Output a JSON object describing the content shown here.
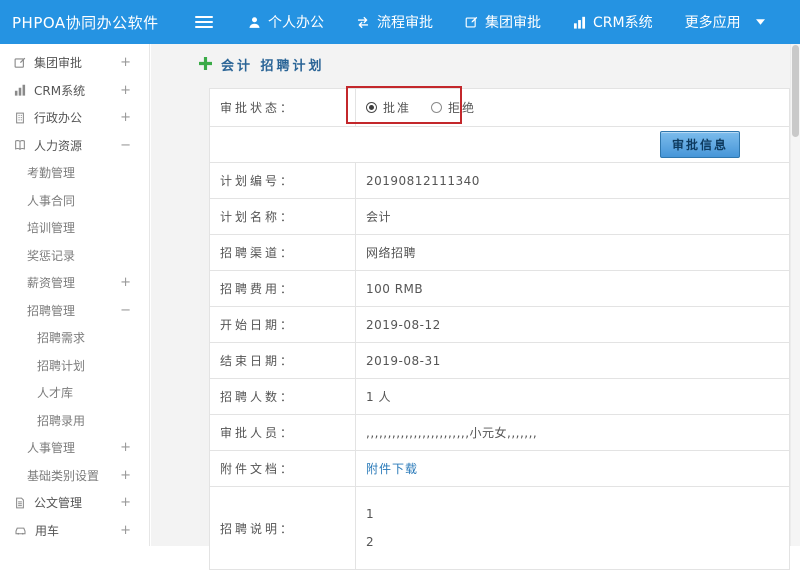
{
  "topbar": {
    "logo": "PHPOA协同办公软件",
    "nav": [
      {
        "label": "个人办公",
        "icon": "person-icon"
      },
      {
        "label": "流程审批",
        "icon": "process-icon"
      },
      {
        "label": "集团审批",
        "icon": "edit-icon"
      },
      {
        "label": "CRM系统",
        "icon": "chart-icon"
      },
      {
        "label": "更多应用",
        "icon": "caret-down-icon"
      }
    ]
  },
  "sidebar": {
    "items": [
      {
        "label": "集团审批",
        "icon": "edit-icon",
        "toggle": "+"
      },
      {
        "label": "CRM系统",
        "icon": "chart-icon",
        "toggle": "+"
      },
      {
        "label": "行政办公",
        "icon": "building-icon",
        "toggle": "+"
      },
      {
        "label": "人力资源",
        "icon": "book-icon",
        "toggle": "−"
      },
      {
        "label": "考勤管理"
      },
      {
        "label": "人事合同"
      },
      {
        "label": "培训管理"
      },
      {
        "label": "奖惩记录"
      },
      {
        "label": "薪资管理",
        "toggle": "+"
      },
      {
        "label": "招聘管理",
        "toggle": "−"
      },
      {
        "label": "招聘需求"
      },
      {
        "label": "招聘计划"
      },
      {
        "label": "人才库"
      },
      {
        "label": "招聘录用"
      },
      {
        "label": "人事管理",
        "toggle": "+"
      },
      {
        "label": "基础类别设置",
        "toggle": "+"
      },
      {
        "label": "公文管理",
        "icon": "doc-icon",
        "toggle": "+"
      },
      {
        "label": "用车",
        "icon": "car-icon",
        "toggle": "+"
      }
    ]
  },
  "main": {
    "breadcrumb": "会计 招聘计划",
    "approval": {
      "label": "审批状态：",
      "options": [
        {
          "label": "批准",
          "checked": true
        },
        {
          "label": "拒绝",
          "checked": false
        }
      ],
      "button_label": "审批信息"
    },
    "fields": [
      {
        "label": "计划编号：",
        "value": "20190812111340"
      },
      {
        "label": "计划名称：",
        "value": "会计"
      },
      {
        "label": "招聘渠道：",
        "value": "网络招聘"
      },
      {
        "label": "招聘费用：",
        "value": "100 RMB"
      },
      {
        "label": "开始日期：",
        "value": "2019-08-12"
      },
      {
        "label": "结束日期：",
        "value": "2019-08-31"
      },
      {
        "label": "招聘人数：",
        "value": "1 人"
      },
      {
        "label": "审批人员：",
        "value": ",,,,,,,,,,,,,,,,,,,,,,,,小元女,,,,,,,"
      },
      {
        "label": "附件文档：",
        "value": "附件下载"
      },
      {
        "label": "招聘说明：",
        "value_lines": [
          "1",
          "2"
        ]
      }
    ]
  },
  "colors": {
    "topbar_blue": "#2593e2",
    "annotation_red": "#c3272b",
    "link_blue": "#2a7ab9",
    "breadcrumb_blue": "#2a6496",
    "plus_green": "#3aab47"
  }
}
